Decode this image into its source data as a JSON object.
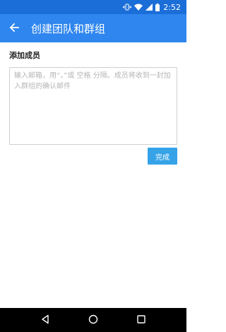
{
  "status_bar": {
    "time": "2:52",
    "icons": [
      "vibrate-icon",
      "wifi-icon",
      "signal-icon",
      "battery-icon"
    ]
  },
  "app_bar": {
    "title": "创建团队和群组",
    "back_icon": "arrow-back-icon"
  },
  "form": {
    "section_label": "添加成员",
    "members_placeholder": "输入邮箱，用“，”或 空格 分隔。成员将收到一封加入群组的确认邮件",
    "members_value": "",
    "done_label": "完成"
  },
  "nav_bar": {
    "buttons": [
      "back-triangle-icon",
      "home-circle-icon",
      "recents-square-icon"
    ]
  },
  "colors": {
    "status_bar": "#1b6ed8",
    "app_bar": "#2f86ee",
    "done_button": "#36a3e8",
    "nav_bar": "#000000"
  }
}
